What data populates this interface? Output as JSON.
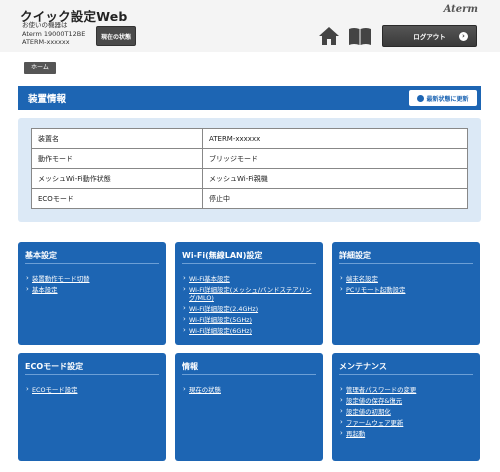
{
  "header": {
    "title": "クイック設定Web",
    "device_info": [
      "お使いの機器は",
      "Aterm 19000T12BE",
      "ATERM-xxxxxx"
    ],
    "status_button": "現在の状態",
    "brand": "Aterm",
    "logout_button": "ログアウト"
  },
  "breadcrumb": "ホーム",
  "section": {
    "title": "装置情報",
    "refresh_button": "最新状態に更新"
  },
  "info_table": [
    {
      "label": "装置名",
      "value": "ATERM-xxxxxx"
    },
    {
      "label": "動作モード",
      "value": "ブリッジモード"
    },
    {
      "label": "メッシュWi-Fi動作状態",
      "value": "メッシュWi-Fi親機"
    },
    {
      "label": "ECOモード",
      "value": "停止中"
    }
  ],
  "cards": [
    {
      "title": "基本設定",
      "items": [
        "装置動作モード切替",
        "基本設定"
      ]
    },
    {
      "title": "Wi-Fi(無線LAN)設定",
      "items": [
        "Wi-Fi基本設定",
        "Wi-Fi詳細設定(メッシュ/バンドステアリング/MLO)",
        "Wi-Fi詳細設定(2.4GHz)",
        "Wi-Fi詳細設定(5GHz)",
        "Wi-Fi詳細設定(6GHz)"
      ]
    },
    {
      "title": "詳細設定",
      "items": [
        "端末名設定",
        "PCリモート起動設定"
      ]
    },
    {
      "title": "ECOモード設定",
      "items": [
        "ECOモード設定"
      ]
    },
    {
      "title": "情報",
      "items": [
        "現在の状態"
      ]
    },
    {
      "title": "メンテナンス",
      "items": [
        "管理者パスワードの変更",
        "設定値の保存&復元",
        "設定値の初期化",
        "ファームウェア更新",
        "再起動"
      ]
    }
  ]
}
